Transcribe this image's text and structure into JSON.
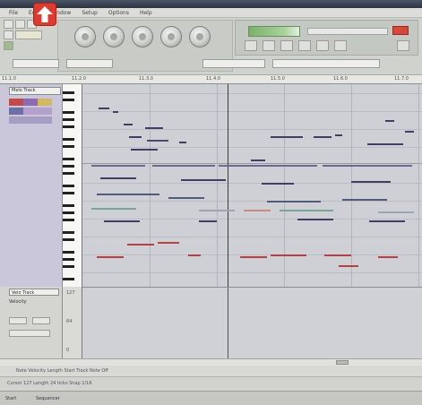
{
  "menubar": {
    "items": [
      "File",
      "Edit",
      "Window",
      "Setup",
      "Options",
      "Help"
    ]
  },
  "track_panel": {
    "header_label": "Melo Track"
  },
  "controller_panel": {
    "header_label": "Velo Track",
    "lane_label": "Velocity",
    "scale_top": "127",
    "scale_mid": "64",
    "scale_low": "0"
  },
  "ruler": {
    "marks": [
      "11.1.0",
      "11.2.0",
      "11.3.0",
      "11.4.0",
      "11.5.0",
      "11.6.0",
      "11.7.0"
    ]
  },
  "status": {
    "line1": "Note Velocity Length Start Track Note Off",
    "line2": "Cursor 127 Length 24 ticks  Snap 1/16"
  },
  "taskbar": {
    "start_label": "Start",
    "task_label": "Sequencer"
  },
  "colors": {
    "accent_red": "#e03a2c",
    "meter_green": "#79b26a",
    "grid_bg": "#cfd0d6",
    "panel_purple": "#c9c7d9"
  }
}
